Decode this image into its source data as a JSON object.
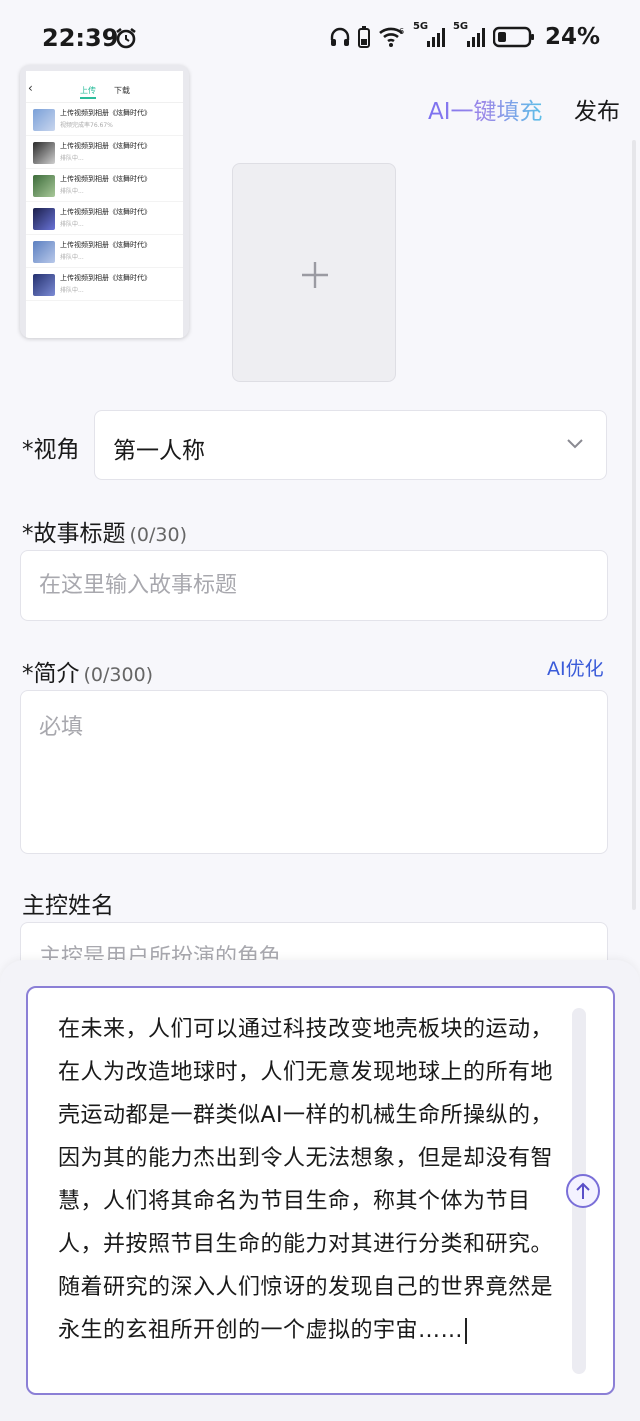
{
  "status_bar": {
    "time": "22:39",
    "network_label_1": "5G",
    "network_label_2": "5G",
    "battery": "24%",
    "icons": [
      "alarm-icon",
      "headphones-icon",
      "phone-battery-icon",
      "wifi-icon",
      "signal-icon",
      "battery-icon"
    ]
  },
  "header": {
    "ai_fill_label": "AI一键填充",
    "publish_label": "发布"
  },
  "screenshot_thumb": {
    "tabs": [
      "上传",
      "下载"
    ],
    "rows": [
      {
        "title": "上传视频到相册《炫舞时代》",
        "sub": "视频完成率76.67%"
      },
      {
        "title": "上传视频到相册《炫舞时代》",
        "sub": "排队中..."
      },
      {
        "title": "上传视频到相册《炫舞时代》",
        "sub": "排队中..."
      },
      {
        "title": "上传视频到相册《炫舞时代》",
        "sub": "排队中..."
      },
      {
        "title": "上传视频到相册《炫舞时代》",
        "sub": "排队中..."
      },
      {
        "title": "上传视频到相册《炫舞时代》",
        "sub": "排队中..."
      }
    ]
  },
  "form": {
    "perspective_label": "*视角",
    "perspective_value": "第一人称",
    "title_label": "*故事标题",
    "title_count": "(0/30)",
    "title_placeholder": "在这里输入故事标题",
    "intro_label": "*简介",
    "intro_count": "(0/300)",
    "intro_ai_optimize": "AI优化",
    "intro_placeholder": "必填",
    "protagonist_label": "主控姓名",
    "protagonist_placeholder": "主控是用户所扮演的角色"
  },
  "story_input": {
    "text": "在未来，人们可以通过科技改变地壳板块的运动，在人为改造地球时，人们无意发现地球上的所有地壳运动都是一群类似AI一样的机械生命所操纵的，因为其的能力杰出到令人无法想象，但是却没有智慧，人们将其命名为节目生命，称其个体为节目人，并按照节目生命的能力对其进行分类和研究。随着研究的深入人们惊讶的发现自己的世界竟然是永生的玄祖所开创的一个虚拟的宇宙……"
  },
  "colors": {
    "accent": "#7b6ff0",
    "link_blue": "#3a5bd9",
    "border_focus": "#8b7fd6"
  }
}
